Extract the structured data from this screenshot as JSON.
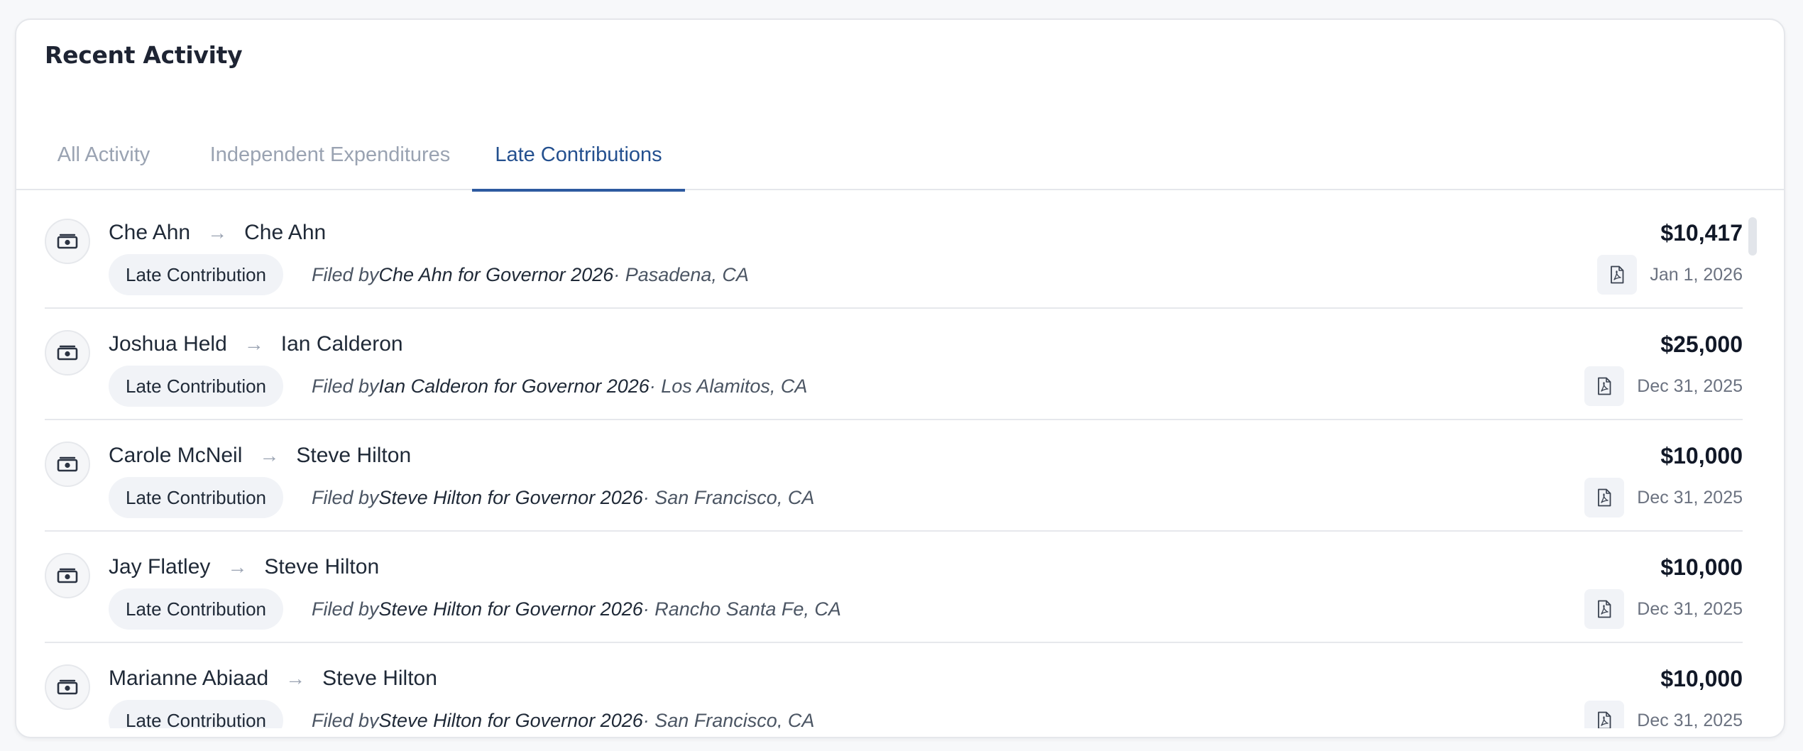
{
  "card": {
    "title": "Recent Activity"
  },
  "tabs": [
    {
      "label": "All Activity"
    },
    {
      "label": "Independent Expenditures"
    },
    {
      "label": "Late Contributions",
      "active": true
    }
  ],
  "colors": {
    "accent": "#2d5aa0",
    "accent_text": "#24508f",
    "badge_bg": "#f1f3f7"
  },
  "icons": {
    "row": "money-icon",
    "document": "pdf-icon"
  },
  "activities": [
    {
      "from": "Che Ahn",
      "to": "Che Ahn",
      "type": "Late Contribution",
      "filed_prefix": "Filed by ",
      "committee": "Che Ahn for Governor 2026",
      "location": " · Pasadena, CA",
      "amount": "$10,417",
      "date": "Jan 1, 2026"
    },
    {
      "from": "Joshua Held",
      "to": "Ian Calderon",
      "type": "Late Contribution",
      "filed_prefix": "Filed by ",
      "committee": "Ian Calderon for Governor 2026",
      "location": " · Los Alamitos, CA",
      "amount": "$25,000",
      "date": "Dec 31, 2025"
    },
    {
      "from": "Carole McNeil",
      "to": "Steve Hilton",
      "type": "Late Contribution",
      "filed_prefix": "Filed by ",
      "committee": "Steve Hilton for Governor 2026",
      "location": " · San Francisco, CA",
      "amount": "$10,000",
      "date": "Dec 31, 2025"
    },
    {
      "from": "Jay Flatley",
      "to": "Steve Hilton",
      "type": "Late Contribution",
      "filed_prefix": "Filed by ",
      "committee": "Steve Hilton for Governor 2026",
      "location": " · Rancho Santa Fe, CA",
      "amount": "$10,000",
      "date": "Dec 31, 2025"
    },
    {
      "from": "Marianne Abiaad",
      "to": "Steve Hilton",
      "type": "Late Contribution",
      "filed_prefix": "Filed by ",
      "committee": "Steve Hilton for Governor 2026",
      "location": " · San Francisco, CA",
      "amount": "$10,000",
      "date": "Dec 31, 2025"
    }
  ]
}
